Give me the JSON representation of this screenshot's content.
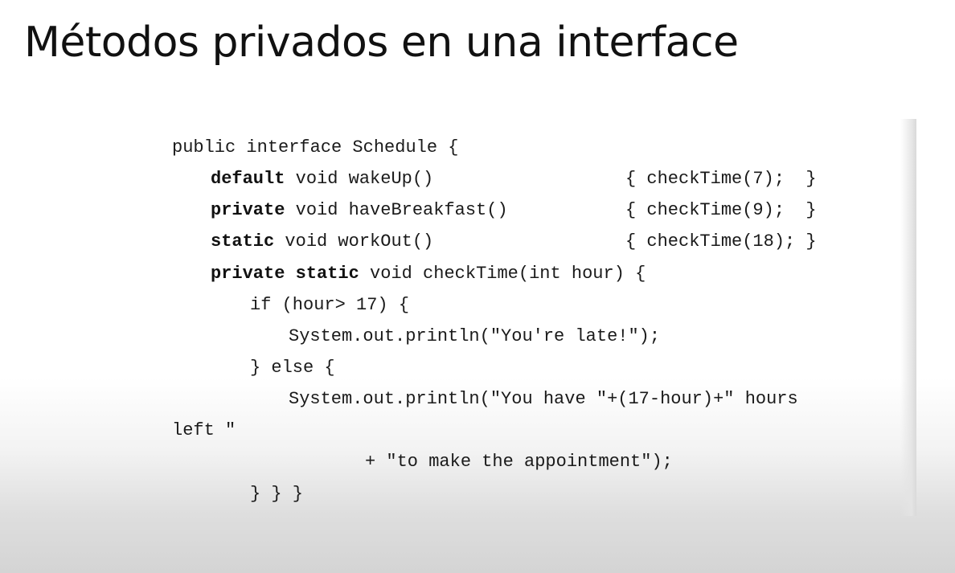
{
  "slide": {
    "title": "Métodos privados en una interface"
  },
  "code": {
    "l1": "public interface Schedule {",
    "l2_kw": "default",
    "l2_sig": " void wakeUp()",
    "l2_body": "{ checkTime(7);  }",
    "l3_kw": "private",
    "l3_sig": " void haveBreakfast()",
    "l3_body": "{ checkTime(9);  }",
    "l4_kw": "static",
    "l4_sig": " void workOut()",
    "l4_body": "{ checkTime(18); }",
    "l5_kw1": "private",
    "l5_sp": " ",
    "l5_kw2": "static",
    "l5_rest": " void checkTime(int hour) {",
    "l6": "if (hour> 17) {",
    "l7": "System.out.println(\"You're late!\");",
    "l8": "} else {",
    "l9": "System.out.println(\"You have \"+(17-hour)+\" hours",
    "l10": "left \"",
    "l11": "+ \"to make the appointment\");",
    "l12": "} } }"
  }
}
